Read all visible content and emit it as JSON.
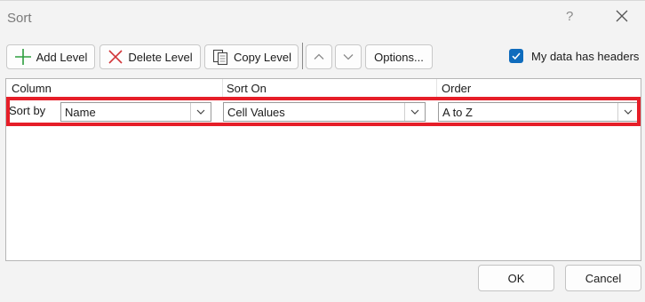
{
  "window": {
    "title": "Sort",
    "help": "?"
  },
  "toolbar": {
    "add_level": "Add Level",
    "delete_level": "Delete Level",
    "copy_level": "Copy Level",
    "options": "Options...",
    "move_up_icon": "chevron-up-icon",
    "move_down_icon": "chevron-down-icon"
  },
  "headers_checkbox": {
    "label": "My data has headers",
    "checked": true
  },
  "grid": {
    "columns": [
      "Column",
      "Sort On",
      "Order"
    ],
    "rows": [
      {
        "label": "Sort by",
        "column": "Name",
        "sort_on": "Cell Values",
        "order": "A to Z"
      }
    ]
  },
  "footer": {
    "ok": "OK",
    "cancel": "Cancel"
  },
  "colors": {
    "accent": "#0f6cbd",
    "highlight": "#e61e28",
    "add_icon": "#2e9e3e",
    "delete_icon": "#d13438"
  }
}
